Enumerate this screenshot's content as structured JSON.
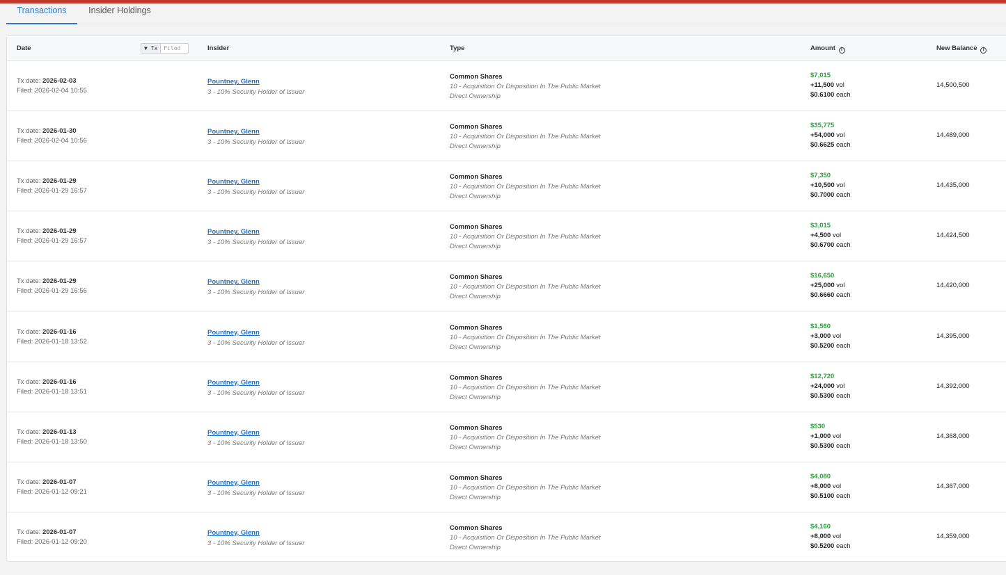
{
  "tabs": [
    {
      "label": "Transactions",
      "active": true
    },
    {
      "label": "Insider Holdings",
      "active": false
    }
  ],
  "table": {
    "columns": {
      "date": "Date",
      "insider": "Insider",
      "type": "Type",
      "amount": "Amount",
      "balance": "New Balance"
    },
    "date_toggle": {
      "tx": "▼ Tx",
      "filed": "Filed",
      "selected": "Tx"
    },
    "info_icon": "i",
    "labels": {
      "tx_date": "Tx date:",
      "filed": "Filed:",
      "vol": "vol",
      "each": "each"
    },
    "rows": [
      {
        "tx_date": "2026-02-03",
        "filed": "2026-02-04 10:55",
        "insider": "Pountney, Glenn",
        "relationship": "3 - 10% Security Holder of Issuer",
        "security": "Common Shares",
        "nature": "10 - Acquisition Or Disposition In The Public Market",
        "ownership": "Direct Ownership",
        "amount": "$7,015",
        "volume": "+11,500",
        "price": "$0.6100",
        "balance": "14,500,500"
      },
      {
        "tx_date": "2026-01-30",
        "filed": "2026-02-04 10:56",
        "insider": "Pountney, Glenn",
        "relationship": "3 - 10% Security Holder of Issuer",
        "security": "Common Shares",
        "nature": "10 - Acquisition Or Disposition In The Public Market",
        "ownership": "Direct Ownership",
        "amount": "$35,775",
        "volume": "+54,000",
        "price": "$0.6625",
        "balance": "14,489,000"
      },
      {
        "tx_date": "2026-01-29",
        "filed": "2026-01-29 16:57",
        "insider": "Pountney, Glenn",
        "relationship": "3 - 10% Security Holder of Issuer",
        "security": "Common Shares",
        "nature": "10 - Acquisition Or Disposition In The Public Market",
        "ownership": "Direct Ownership",
        "amount": "$7,350",
        "volume": "+10,500",
        "price": "$0.7000",
        "balance": "14,435,000"
      },
      {
        "tx_date": "2026-01-29",
        "filed": "2026-01-29 16:57",
        "insider": "Pountney, Glenn",
        "relationship": "3 - 10% Security Holder of Issuer",
        "security": "Common Shares",
        "nature": "10 - Acquisition Or Disposition In The Public Market",
        "ownership": "Direct Ownership",
        "amount": "$3,015",
        "volume": "+4,500",
        "price": "$0.6700",
        "balance": "14,424,500"
      },
      {
        "tx_date": "2026-01-29",
        "filed": "2026-01-29 16:56",
        "insider": "Pountney, Glenn",
        "relationship": "3 - 10% Security Holder of Issuer",
        "security": "Common Shares",
        "nature": "10 - Acquisition Or Disposition In The Public Market",
        "ownership": "Direct Ownership",
        "amount": "$16,650",
        "volume": "+25,000",
        "price": "$0.6660",
        "balance": "14,420,000"
      },
      {
        "tx_date": "2026-01-16",
        "filed": "2026-01-18 13:52",
        "insider": "Pountney, Glenn",
        "relationship": "3 - 10% Security Holder of Issuer",
        "security": "Common Shares",
        "nature": "10 - Acquisition Or Disposition In The Public Market",
        "ownership": "Direct Ownership",
        "amount": "$1,560",
        "volume": "+3,000",
        "price": "$0.5200",
        "balance": "14,395,000"
      },
      {
        "tx_date": "2026-01-16",
        "filed": "2026-01-18 13:51",
        "insider": "Pountney, Glenn",
        "relationship": "3 - 10% Security Holder of Issuer",
        "security": "Common Shares",
        "nature": "10 - Acquisition Or Disposition In The Public Market",
        "ownership": "Direct Ownership",
        "amount": "$12,720",
        "volume": "+24,000",
        "price": "$0.5300",
        "balance": "14,392,000"
      },
      {
        "tx_date": "2026-01-13",
        "filed": "2026-01-18 13:50",
        "insider": "Pountney, Glenn",
        "relationship": "3 - 10% Security Holder of Issuer",
        "security": "Common Shares",
        "nature": "10 - Acquisition Or Disposition In The Public Market",
        "ownership": "Direct Ownership",
        "amount": "$530",
        "volume": "+1,000",
        "price": "$0.5300",
        "balance": "14,368,000"
      },
      {
        "tx_date": "2026-01-07",
        "filed": "2026-01-12 09:21",
        "insider": "Pountney, Glenn",
        "relationship": "3 - 10% Security Holder of Issuer",
        "security": "Common Shares",
        "nature": "10 - Acquisition Or Disposition In The Public Market",
        "ownership": "Direct Ownership",
        "amount": "$4,080",
        "volume": "+8,000",
        "price": "$0.5100",
        "balance": "14,367,000"
      },
      {
        "tx_date": "2026-01-07",
        "filed": "2026-01-12 09:20",
        "insider": "Pountney, Glenn",
        "relationship": "3 - 10% Security Holder of Issuer",
        "security": "Common Shares",
        "nature": "10 - Acquisition Or Disposition In The Public Market",
        "ownership": "Direct Ownership",
        "amount": "$4,160",
        "volume": "+8,000",
        "price": "$0.5200",
        "balance": "14,359,000"
      }
    ]
  },
  "colors": {
    "accent": "#2e7bd6",
    "top_bar": "#c0392b",
    "positive": "#2e9e3f",
    "link": "#1f6fc6"
  }
}
